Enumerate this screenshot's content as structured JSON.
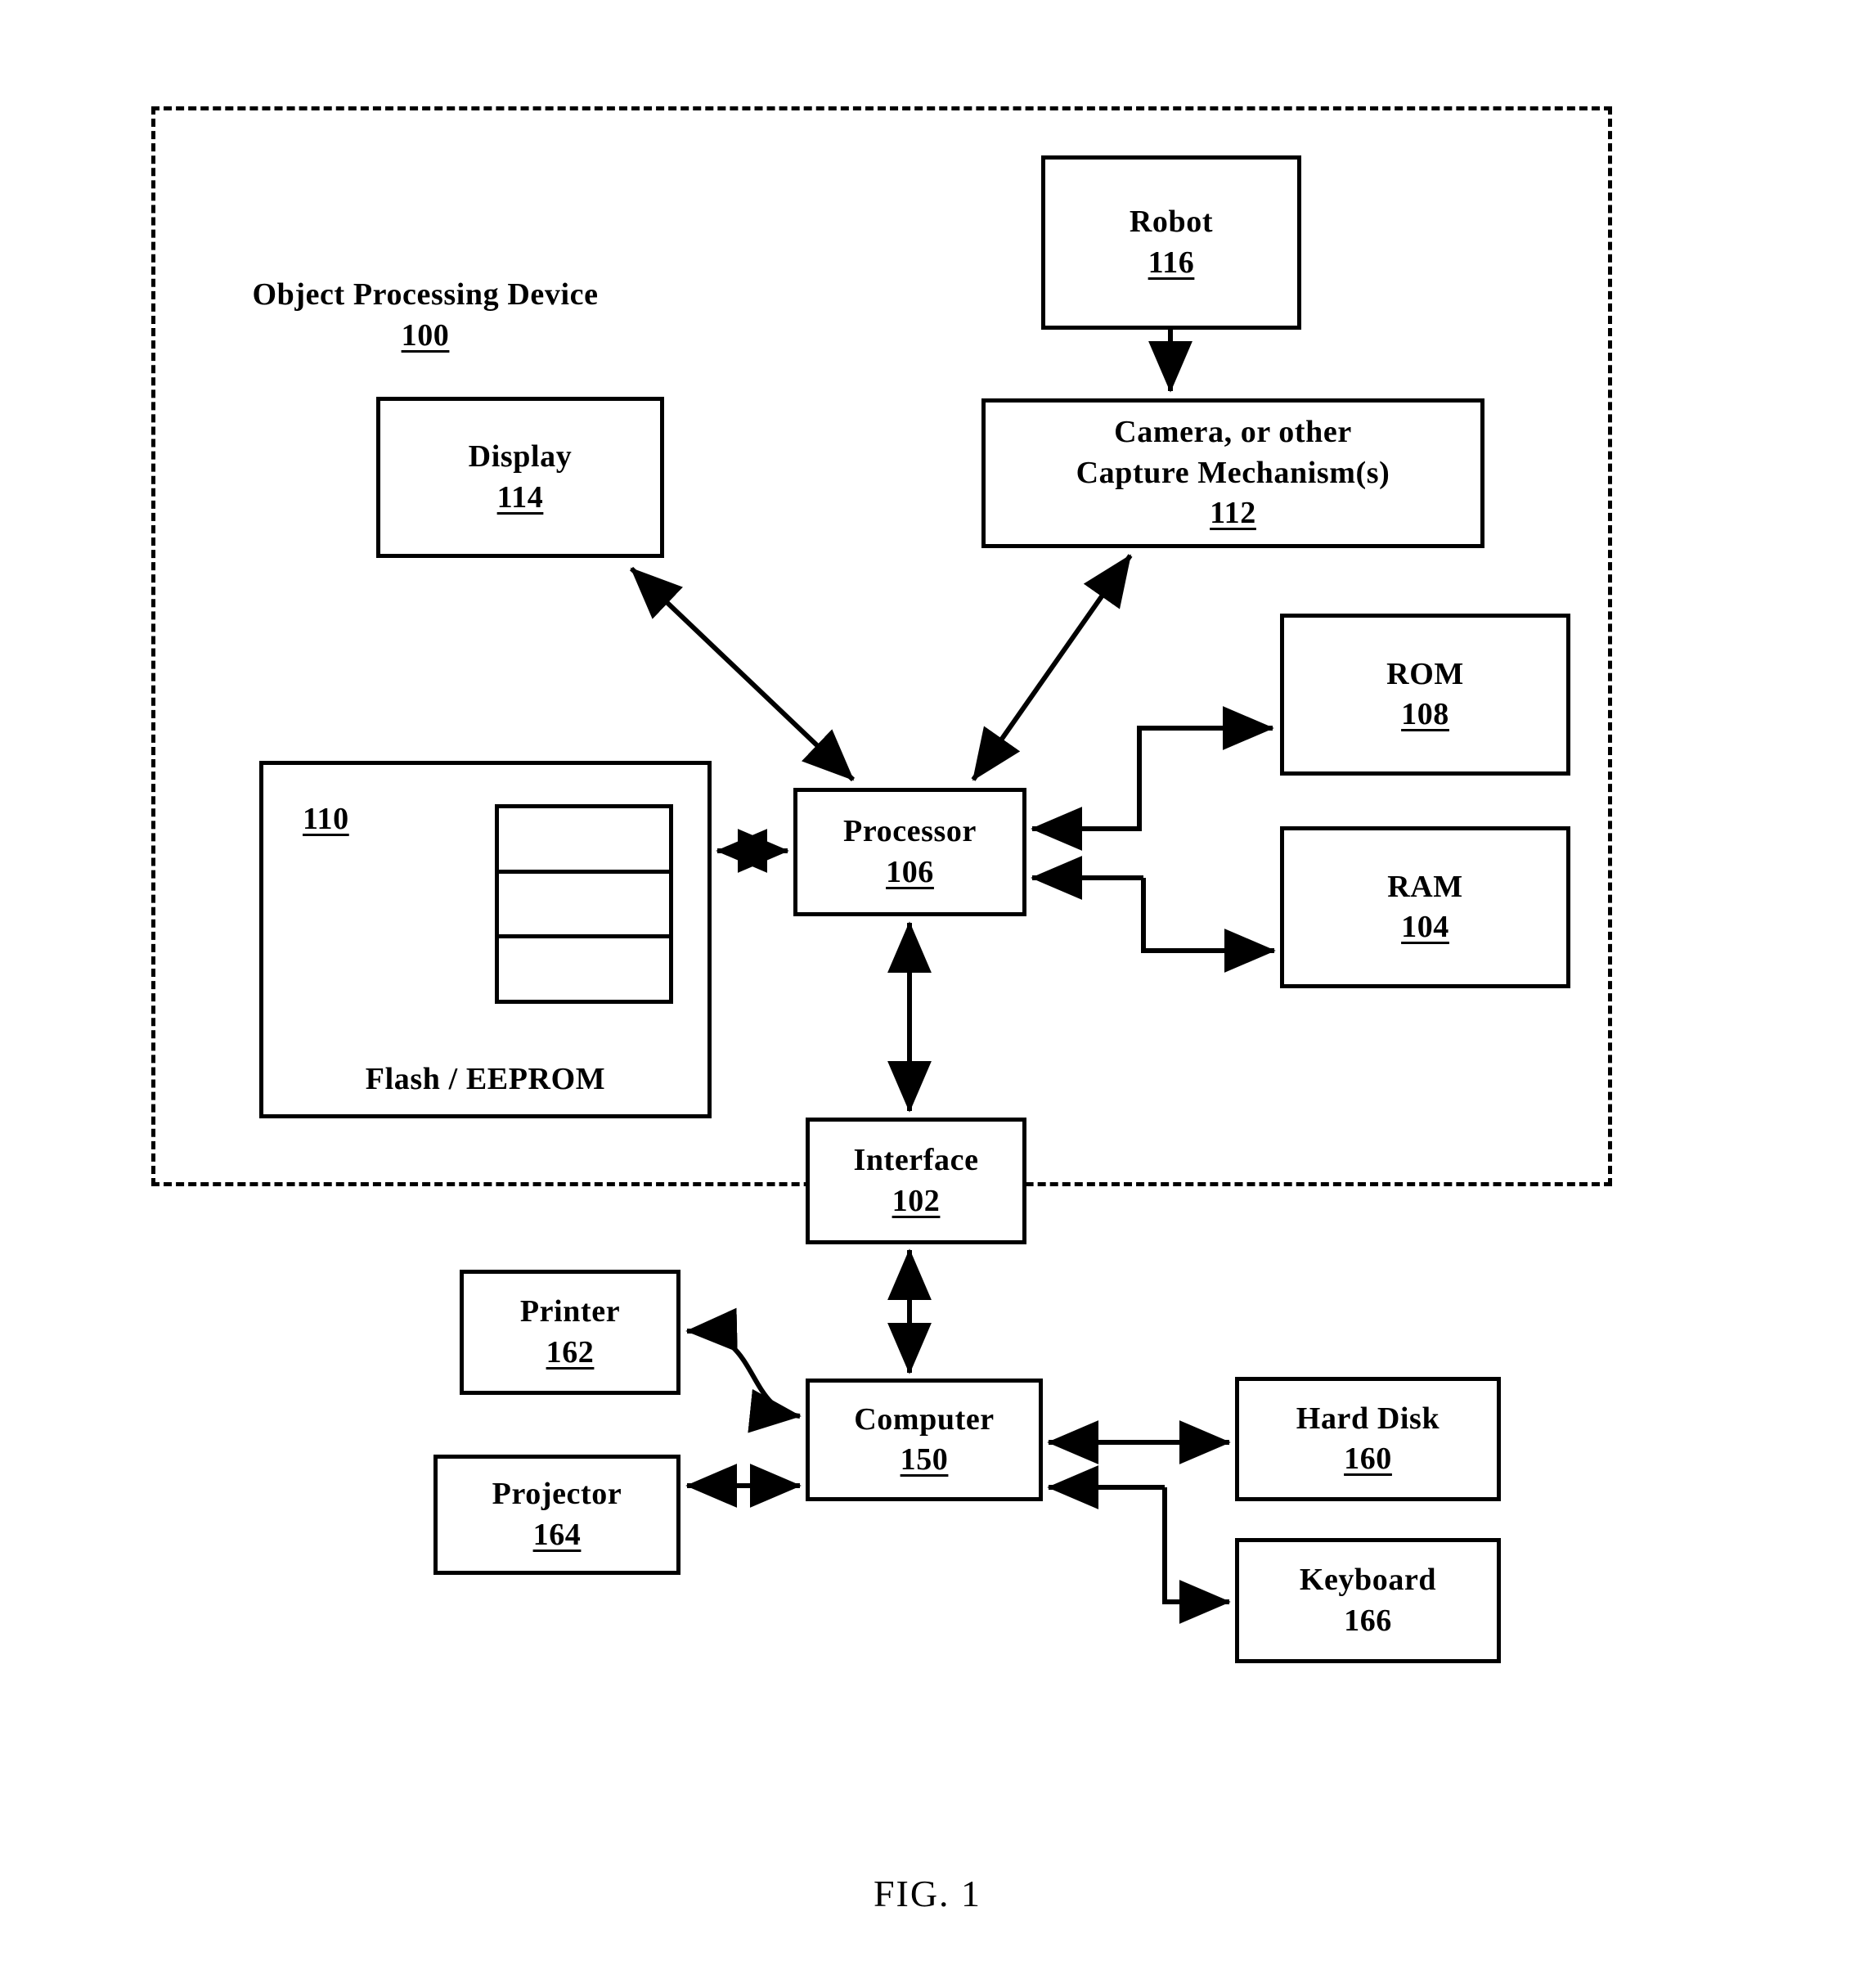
{
  "figure": {
    "caption": "FIG. 1"
  },
  "boundary": {
    "label_title": "Object Processing Device",
    "label_ref": "100"
  },
  "nodes": {
    "robot": {
      "title": "Robot",
      "ref": "116",
      "ref_underlined": true
    },
    "camera": {
      "title_line1": "Camera, or other",
      "title_line2": "Capture Mechanism(s)",
      "ref": "112",
      "ref_underlined": true
    },
    "display": {
      "title": "Display",
      "ref": "114",
      "ref_underlined": true
    },
    "rom": {
      "title": "ROM",
      "ref": "108",
      "ref_underlined": true
    },
    "ram": {
      "title": "RAM",
      "ref": "104",
      "ref_underlined": true
    },
    "processor": {
      "title": "Processor",
      "ref": "106",
      "ref_underlined": true
    },
    "flash": {
      "caption": "Flash / EEPROM",
      "ref": "110",
      "ref_underlined": true,
      "cells": 3
    },
    "interface": {
      "title": "Interface",
      "ref": "102",
      "ref_underlined": true
    },
    "computer": {
      "title": "Computer",
      "ref": "150",
      "ref_underlined": true
    },
    "printer": {
      "title": "Printer",
      "ref": "162",
      "ref_underlined": true
    },
    "projector": {
      "title": "Projector",
      "ref": "164",
      "ref_underlined": true
    },
    "harddisk": {
      "title": "Hard Disk",
      "ref": "160",
      "ref_underlined": true
    },
    "keyboard": {
      "title": "Keyboard",
      "ref": "166",
      "ref_underlined": false
    }
  },
  "colors": {
    "stroke": "#000000",
    "background": "#ffffff"
  }
}
